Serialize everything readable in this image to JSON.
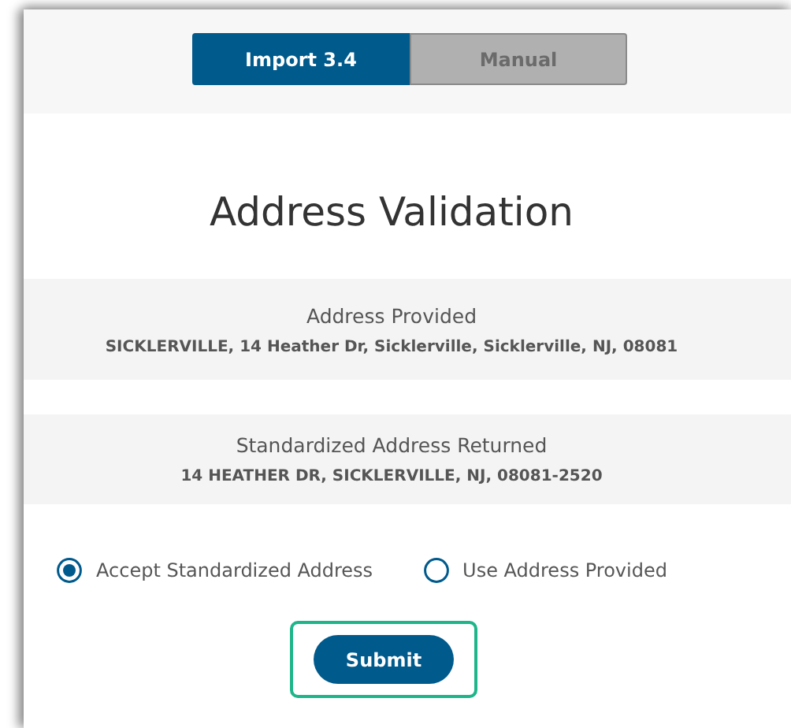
{
  "tabs": [
    {
      "label": "Import 3.4",
      "selected": true
    },
    {
      "label": "Manual",
      "selected": false
    }
  ],
  "title": "Address Validation",
  "sections": [
    {
      "heading": "Address Provided",
      "address": "SICKLERVILLE, 14 Heather Dr, Sicklerville, Sicklerville, NJ, 08081"
    },
    {
      "heading": "Standardized Address Returned",
      "address": "14 HEATHER DR, SICKLERVILLE, NJ, 08081-2520"
    }
  ],
  "options": [
    {
      "label": "Accept Standardized Address",
      "selected": true
    },
    {
      "label": "Use Address Provided",
      "selected": false
    }
  ],
  "submit": {
    "label": "Submit",
    "highlighted": true
  }
}
